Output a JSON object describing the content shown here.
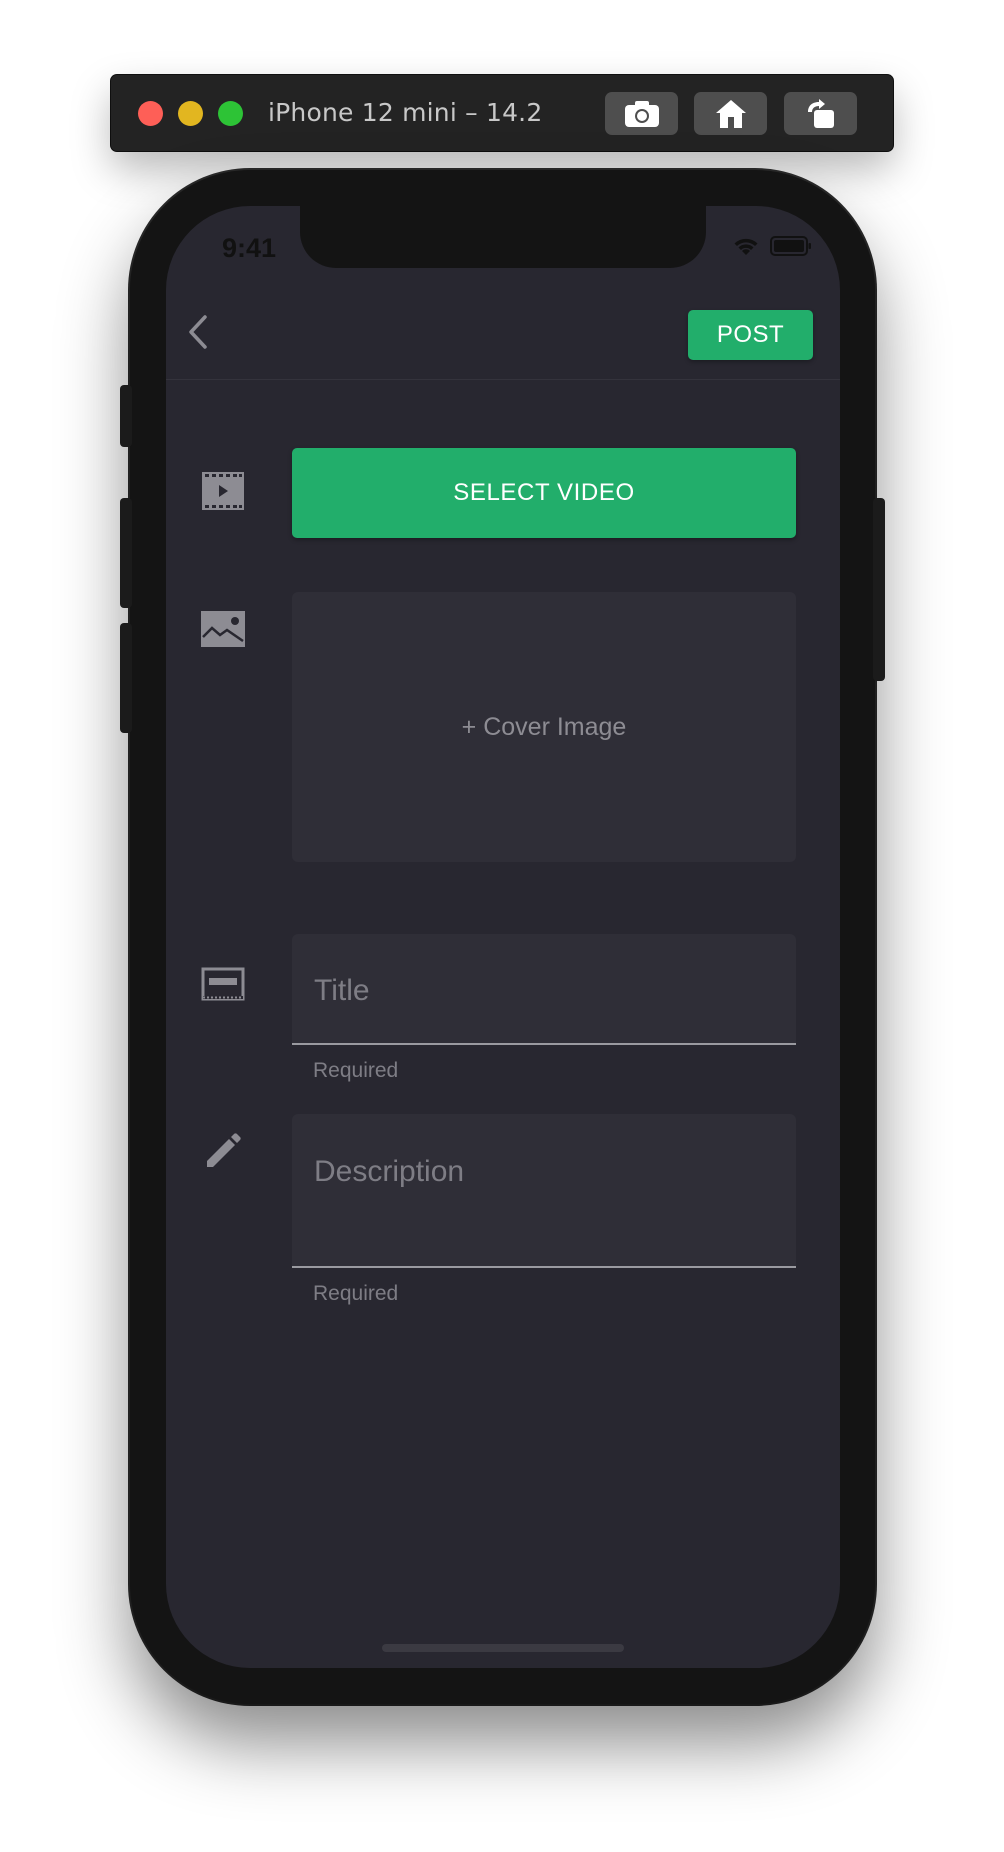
{
  "simulator": {
    "title": "iPhone 12 mini – 14.2",
    "buttons": [
      "screenshot-icon",
      "home-icon",
      "rotate-icon"
    ],
    "traffic_colors": {
      "close": "#fe5f57",
      "minimize": "#e2b620",
      "maximize": "#2dc336"
    }
  },
  "status_bar": {
    "time": "9:41"
  },
  "nav": {
    "post_label": "POST"
  },
  "form": {
    "select_video_label": "SELECT VIDEO",
    "cover_image_label": "+ Cover Image",
    "title_placeholder": "Title",
    "title_helper": "Required",
    "description_placeholder": "Description",
    "description_helper": "Required"
  },
  "colors": {
    "accent": "#22ae6b",
    "screen_bg": "#282730",
    "field_bg": "#2f2e37"
  }
}
